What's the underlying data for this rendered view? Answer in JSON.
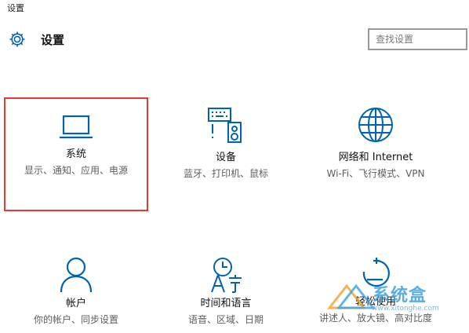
{
  "window": {
    "title": "设置"
  },
  "header": {
    "title": "设置",
    "icon": "gear-icon"
  },
  "search": {
    "placeholder": "查找设置"
  },
  "accent_color": "#0063b1",
  "selection_color": "#e53935",
  "tiles": [
    {
      "name": "系统",
      "desc": "显示、通知、应用、电源",
      "icon": "laptop-icon",
      "selected": true
    },
    {
      "name": "设备",
      "desc": "蓝牙、打印机、鼠标",
      "icon": "devices-icon"
    },
    {
      "name": "网络和 Internet",
      "desc": "Wi-Fi、飞行模式、VPN",
      "icon": "globe-icon"
    },
    {
      "name": "帐户",
      "desc": "你的帐户、同步设置",
      "icon": "person-icon"
    },
    {
      "name": "时间和语言",
      "desc": "语音、区域、日期",
      "icon": "time-language-icon"
    },
    {
      "name": "轻松使用",
      "desc": "讲述人、放大镜、高对比度",
      "icon": "ease-of-access-icon"
    }
  ],
  "watermark": {
    "text": "系统盒",
    "url": "www.xitonghe.com"
  }
}
